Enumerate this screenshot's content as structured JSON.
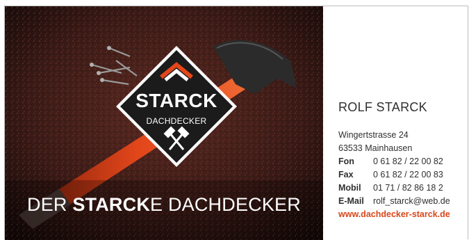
{
  "logo": {
    "brand": "STARCK",
    "subtitle": "DACHDECKER"
  },
  "slogan": {
    "part1": "DER ",
    "bold": "STARCK",
    "part2": "E DACHDECKER"
  },
  "contact": {
    "name": "ROLF STARCK",
    "street": "Wingertstrasse 24",
    "city": "63533 Mainhausen",
    "phone_label": "Fon",
    "phone": "0 61 82 / 22 00 82",
    "fax_label": "Fax",
    "fax": "0 61 82 / 22 00 83",
    "mobile_label": "Mobil",
    "mobile": "01 71 / 82 86 18 2",
    "email_label": "E-Mail",
    "email": "rolf_starck@web.de",
    "website": "www.dachdecker-starck.de"
  },
  "colors": {
    "accent": "#d9471b",
    "logo_bg": "#1b1b1b",
    "hammer_handle": "#e2461a"
  }
}
